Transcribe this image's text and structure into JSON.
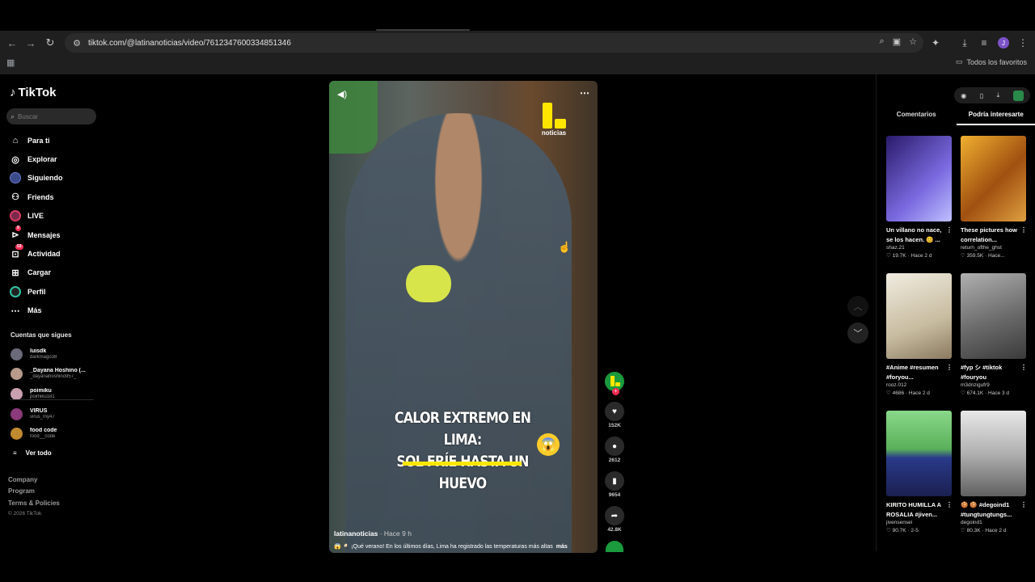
{
  "browser": {
    "url": "tiktok.com/@latinanoticias/video/7612347600334851346",
    "profile_initial": "J",
    "bookmarks_label": "Todos los favoritos"
  },
  "sidebar": {
    "logo": "TikTok",
    "search_placeholder": "Buscar",
    "menu": [
      {
        "label": "Para ti",
        "icon": "home-icon"
      },
      {
        "label": "Explorar",
        "icon": "compass-icon"
      },
      {
        "label": "Siguiendo",
        "icon": "following-avatar-icon"
      },
      {
        "label": "Friends",
        "icon": "friends-icon"
      },
      {
        "label": "LIVE",
        "icon": "live-icon"
      },
      {
        "label": "Mensajes",
        "icon": "messages-icon",
        "badge": "9"
      },
      {
        "label": "Actividad",
        "icon": "activity-icon",
        "badge": "53"
      },
      {
        "label": "Cargar",
        "icon": "upload-icon"
      },
      {
        "label": "Perfil",
        "icon": "profile-icon"
      },
      {
        "label": "Más",
        "icon": "more-icon"
      }
    ],
    "following_title": "Cuentas que sigues",
    "following": [
      {
        "name": "luisdk",
        "user": "darkmago38",
        "color": "#6a6a7a"
      },
      {
        "name": "_Dayana Hoshino (...",
        "user": "_dayanahoshino957_",
        "color": "#b79a8a"
      },
      {
        "name": "poimiku",
        "user": "poimiku181",
        "color": "#c9a0b0"
      },
      {
        "name": "VIRUS",
        "user": "virus_my47",
        "color": "#8a3a7a"
      },
      {
        "name": "food code",
        "user": "food__code",
        "color": "#c08a30"
      }
    ],
    "see_all": "Ver todo",
    "footer": [
      "Company",
      "Program",
      "Terms & Policies"
    ],
    "copyright": "© 2026 TikTok"
  },
  "video": {
    "brand_text": "noticias",
    "caption_line1": "CALOR EXTREMO EN LIMA:",
    "caption_line2": "SOL FRÍE HASTA UN HUEVO",
    "author": "latinanoticias",
    "ago": "· Hace 9 h",
    "description": "😱 🍳 ¡Qué verano! En los últimos días, Lima ha registrado las temperaturas más altas",
    "more": "más"
  },
  "actions": {
    "likes": "152K",
    "comments": "2612",
    "saves": "9654",
    "shares": "42.8K"
  },
  "panel": {
    "tab_comments": "Comentarios",
    "tab_suggested": "Podría interesarte",
    "cards": [
      {
        "title": "Un villano no nace, se los hacen. 😊 ...",
        "user": "shaz.21",
        "likes": "19.7K",
        "ago": "Hace 2 d",
        "color1": "#2a1a6a",
        "color2": "#7a6ae0"
      },
      {
        "title": "These pictures how correlation...",
        "user": "return_ofthe_ghst",
        "likes": "359.5K",
        "ago": "Hace...",
        "color1": "#e0a020",
        "color2": "#a05010"
      },
      {
        "title": "#Anime #resumen #foryou...",
        "user": "rooz.012",
        "likes": "4686",
        "ago": "Hace 2 d",
        "color1": "#e8e0d0",
        "color2": "#b0a890"
      },
      {
        "title": "#fyp シ #tiktok #fouryou",
        "user": "m3dnzigufr9",
        "likes": "674.1K",
        "ago": "Hace 3 d",
        "color1": "#8a8a8a",
        "color2": "#5a5a5a"
      },
      {
        "title": "KIRITO HUMILLA A ROSALIA #jiven...",
        "user": "jivensensei",
        "likes": "90.7K",
        "ago": "2-5",
        "color1": "#7ad07a",
        "color2": "#2a3a8a"
      },
      {
        "title": "🍪 🍪 #degoind1 #tungtungtungs...",
        "user": "degoind1",
        "likes": "80.3K",
        "ago": "Hace 2 d",
        "color1": "#e0e0e0",
        "color2": "#707070"
      }
    ]
  }
}
